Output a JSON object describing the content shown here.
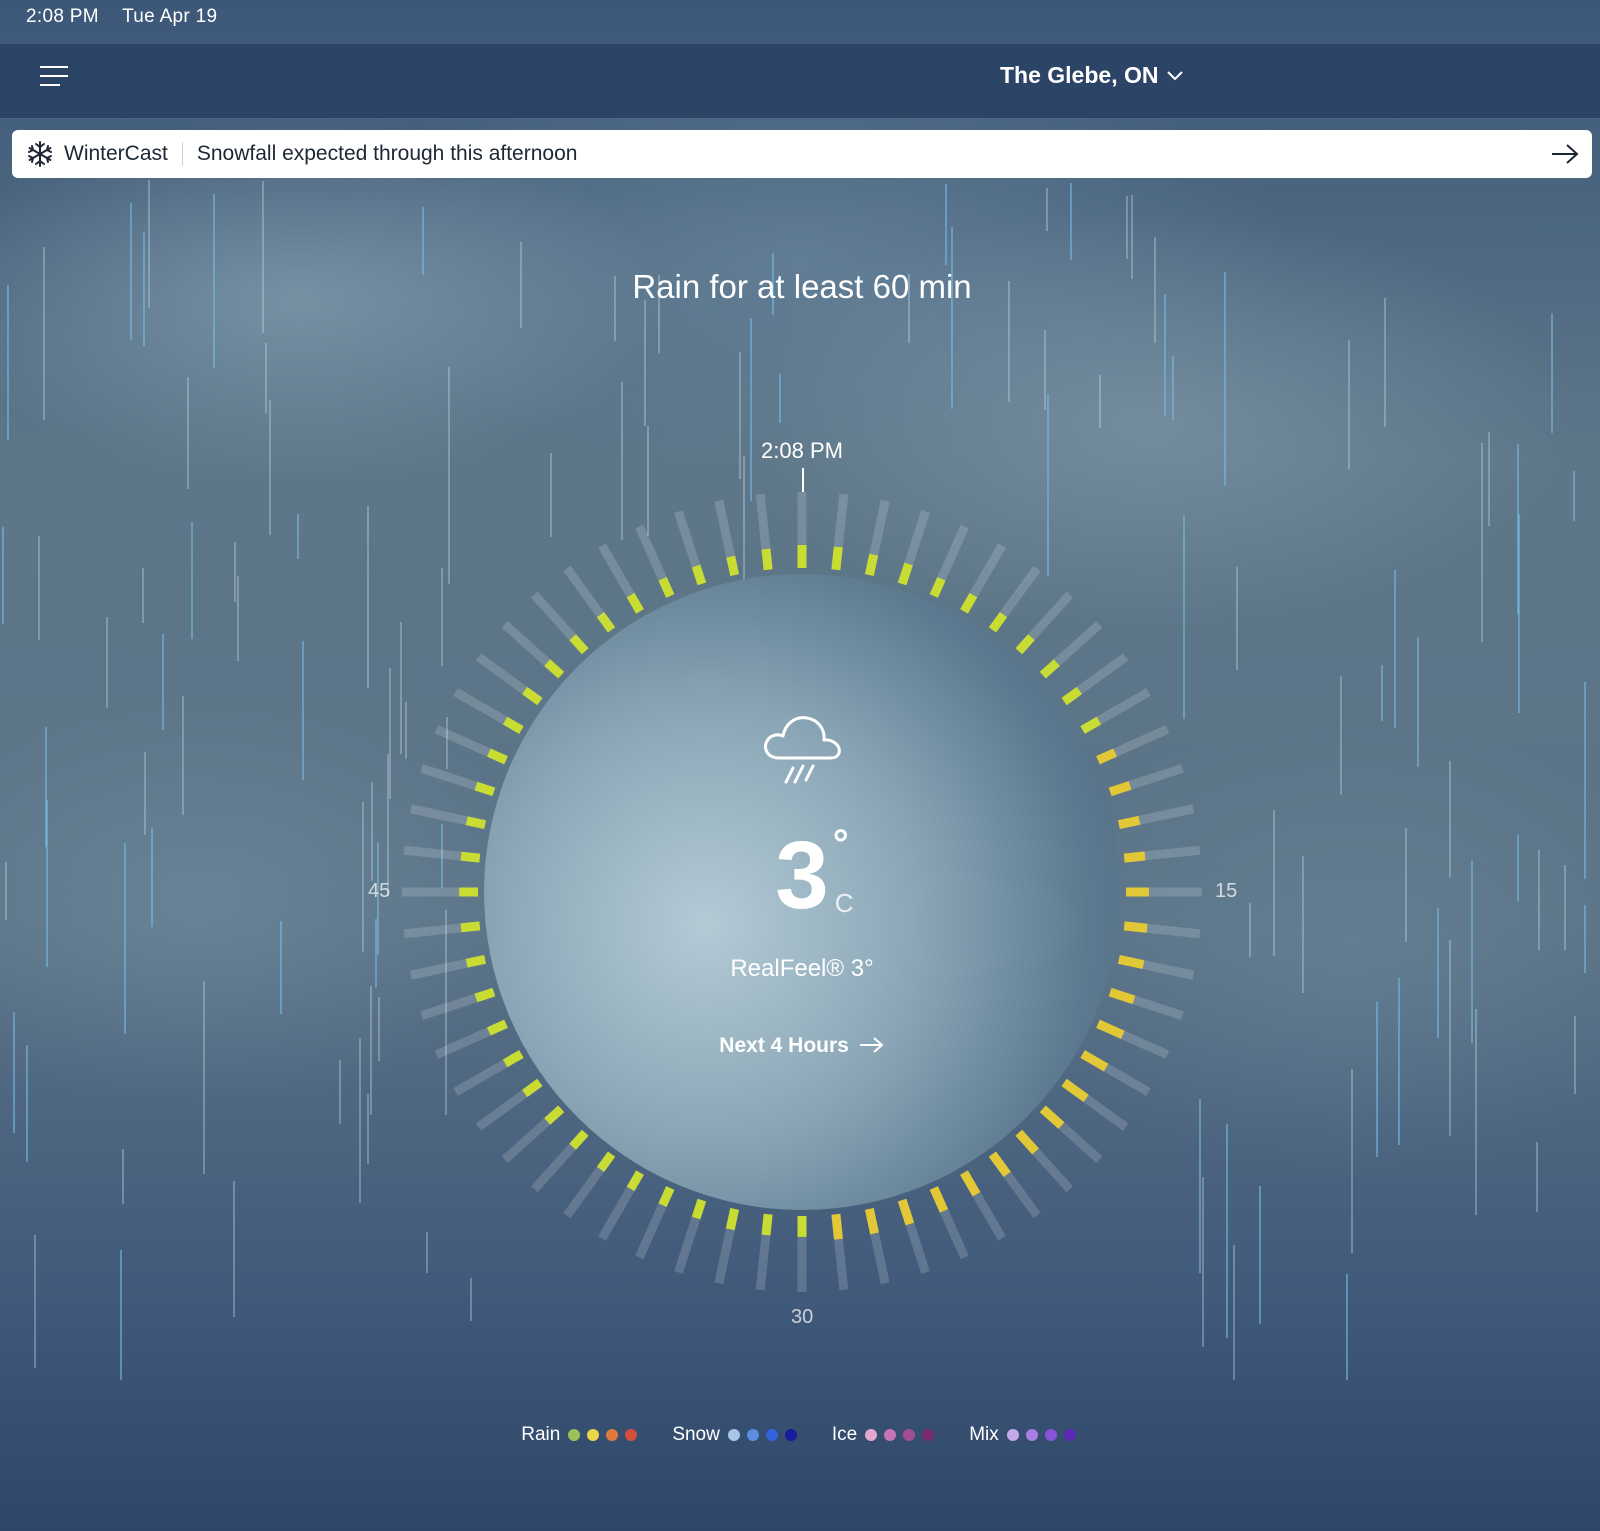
{
  "status_bar": {
    "time": "2:08 PM",
    "date": "Tue Apr 19"
  },
  "header": {
    "location": "The Glebe, ON"
  },
  "banner": {
    "brand": "WinterCast",
    "message": "Snowfall expected through this afternoon"
  },
  "headline": "Rain for at least 60 min",
  "dial": {
    "now_label": "2:08 PM",
    "minute_labels": {
      "right": "15",
      "bottom": "30",
      "left": "45"
    },
    "intensity_fraction": [
      0.55,
      0.55,
      0.5,
      0.5,
      0.45,
      0.45,
      0.45,
      0.45,
      0.45,
      0.45,
      0.45,
      0.45,
      0.5,
      0.5,
      0.5,
      0.55,
      0.55,
      0.6,
      0.6,
      0.65,
      0.65,
      0.65,
      0.6,
      0.6,
      0.6,
      0.6,
      0.6,
      0.6,
      0.6,
      0.6,
      0.5,
      0.5,
      0.5,
      0.45,
      0.45,
      0.45,
      0.45,
      0.45,
      0.45,
      0.45,
      0.45,
      0.45,
      0.45,
      0.45,
      0.45,
      0.45,
      0.45,
      0.45,
      0.45,
      0.45,
      0.45,
      0.45,
      0.45,
      0.45,
      0.45,
      0.45,
      0.45,
      0.45,
      0.45,
      0.5
    ]
  },
  "current": {
    "icon": "cloud-rain-icon",
    "temperature": "3",
    "degree_symbol": "°",
    "unit": "C",
    "realfeel": "RealFeel® 3°",
    "next_hours": "Next 4 Hours"
  },
  "legend": [
    {
      "label": "Rain",
      "colors": [
        "#9ac25a",
        "#e8d74a",
        "#e07a3a",
        "#d4503c"
      ]
    },
    {
      "label": "Snow",
      "colors": [
        "#a9c6e8",
        "#5b8fe0",
        "#3463e0",
        "#1a1a9c"
      ]
    },
    {
      "label": "Ice",
      "colors": [
        "#e2a8d0",
        "#c874b4",
        "#a44c98",
        "#7a2a6e"
      ]
    },
    {
      "label": "Mix",
      "colors": [
        "#c8a8ec",
        "#a87ee0",
        "#8a54d8",
        "#5a2ab4"
      ]
    }
  ],
  "colors": {
    "topbar": "#2c4465",
    "rain_tick_light": "#c8dc34",
    "rain_tick_dark": "#e2c836",
    "track": "rgba(255,255,255,0.16)"
  }
}
